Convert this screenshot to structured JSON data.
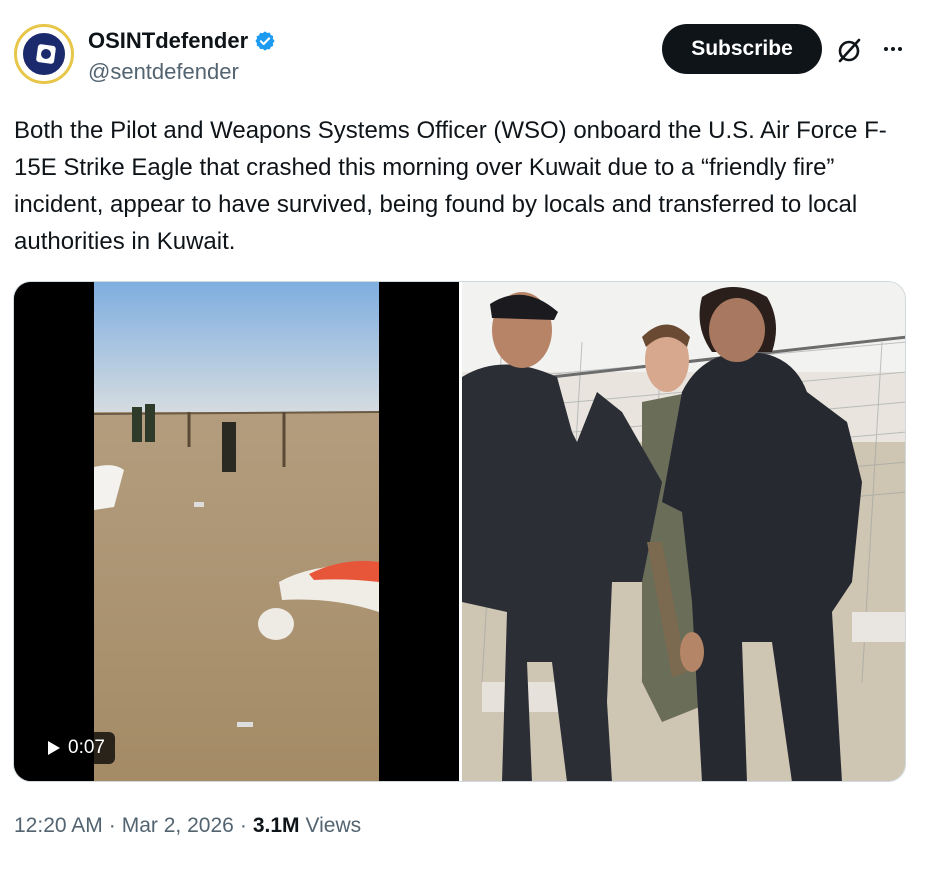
{
  "author": {
    "display_name": "OSINTdefender",
    "handle": "@sentdefender",
    "verified": true,
    "avatar_icon": "osint-defender-logo",
    "verified_color": "#1d9bf0"
  },
  "actions": {
    "subscribe_label": "Subscribe",
    "grok_icon": "grok-icon",
    "more_icon": "more-options-icon"
  },
  "tweet": {
    "text": "Both the Pilot and Weapons Systems Officer (WSO) onboard the U.S. Air Force F-15E Strike Eagle that crashed this morning over Kuwait due to a “friendly fire” incident, appear to have survived, being found by locals and transferred to local authorities in Kuwait."
  },
  "media": {
    "video": {
      "duration": "0:07",
      "icon": "play-icon",
      "description_colors": {
        "sky": "#9cc3e4",
        "ground": "#b49c78"
      }
    },
    "photo": {
      "icon": "photo"
    }
  },
  "meta": {
    "time": "12:20 AM",
    "separator": "·",
    "date": "Mar 2, 2026",
    "views_count": "3.1M",
    "views_label": "Views"
  }
}
